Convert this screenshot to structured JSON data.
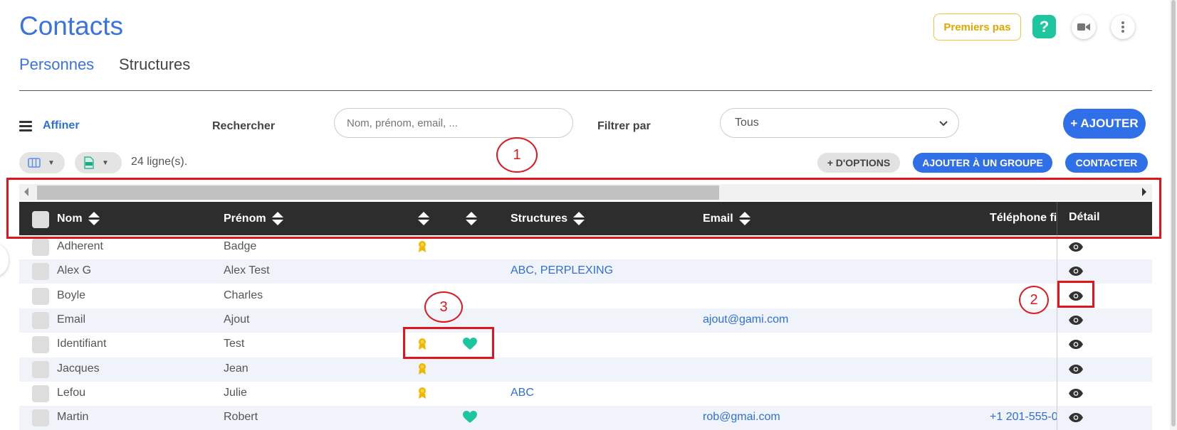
{
  "page": {
    "title": "Contacts"
  },
  "tabs": [
    {
      "label": "Personnes",
      "active": true
    },
    {
      "label": "Structures",
      "active": false
    }
  ],
  "header_actions": {
    "premiers_pas": "Premiers pas",
    "help": "?"
  },
  "toolbar": {
    "affiner": "Affiner",
    "rechercher_label": "Rechercher",
    "search_placeholder": "Nom, prénom, email, ...",
    "filtrer_label": "Filtrer par",
    "filter_value": "Tous",
    "add_label": "+ AJOUTER"
  },
  "subtoolbar": {
    "rows_count": "24 ligne(s).",
    "options_label": "+ D'OPTIONS",
    "add_group_label": "AJOUTER À UN GROUPE",
    "contact_label": "CONTACTER"
  },
  "table": {
    "columns": [
      "Nom",
      "Prénom",
      "",
      "",
      "Structures",
      "Email",
      "Téléphone fix",
      "Détail"
    ],
    "rows": [
      {
        "nom": "Adherent",
        "prenom": "Badge",
        "medal": true,
        "heart": false,
        "structures": "",
        "email": "",
        "phone": ""
      },
      {
        "nom": "Alex G",
        "prenom": "Alex Test",
        "medal": false,
        "heart": false,
        "structures": "ABC, PERPLEXING",
        "email": "",
        "phone": ""
      },
      {
        "nom": "Boyle",
        "prenom": "Charles",
        "medal": false,
        "heart": false,
        "structures": "",
        "email": "",
        "phone": ""
      },
      {
        "nom": "Email",
        "prenom": "Ajout",
        "medal": false,
        "heart": false,
        "structures": "",
        "email": "ajout@gami.com",
        "phone": ""
      },
      {
        "nom": "Identifiant",
        "prenom": "Test",
        "medal": true,
        "heart": true,
        "structures": "",
        "email": "",
        "phone": ""
      },
      {
        "nom": "Jacques",
        "prenom": "Jean",
        "medal": true,
        "heart": false,
        "structures": "",
        "email": "",
        "phone": ""
      },
      {
        "nom": "Lefou",
        "prenom": "Julie",
        "medal": true,
        "heart": false,
        "structures": "ABC",
        "email": "",
        "phone": ""
      },
      {
        "nom": "Martin",
        "prenom": "Robert",
        "medal": false,
        "heart": true,
        "structures": "",
        "email": "rob@gmai.com",
        "phone": "+1 201-555-0"
      }
    ]
  },
  "annotations": [
    "1",
    "2",
    "3"
  ],
  "colors": {
    "accent": "#2f6fe8",
    "annotation": "#e0161e",
    "heart": "#1ec6a0",
    "medal": "#f2b705",
    "header_bg": "#2d2d2d"
  }
}
